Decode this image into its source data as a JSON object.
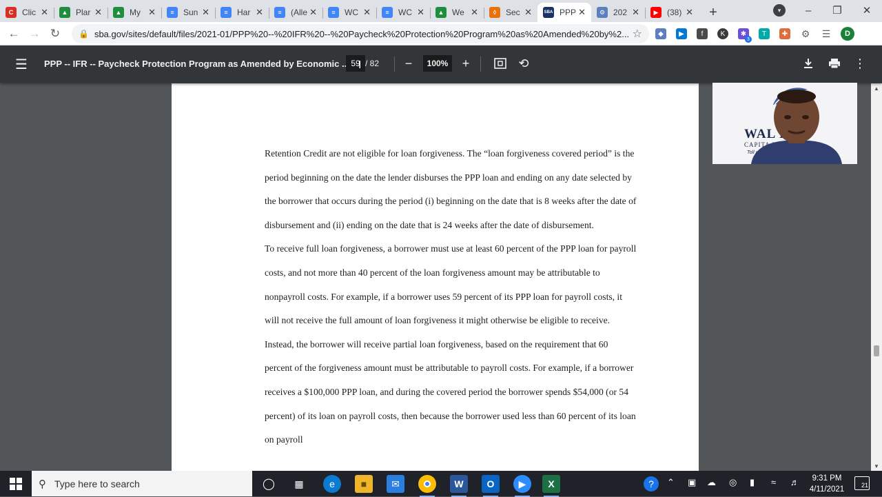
{
  "browser": {
    "tabs": [
      {
        "title": "Clic",
        "fav_color": "#d93025",
        "fav_glyph": "C",
        "icon": "clickup-icon"
      },
      {
        "title": "Plar",
        "fav_color": "#1e8e3e",
        "fav_glyph": "▲",
        "icon": "google-drive-icon"
      },
      {
        "title": "My",
        "fav_color": "#1e8e3e",
        "fav_glyph": "▲",
        "icon": "google-drive-icon"
      },
      {
        "title": "Sun",
        "fav_color": "#4285f4",
        "fav_glyph": "≡",
        "icon": "google-docs-icon"
      },
      {
        "title": "Har",
        "fav_color": "#4285f4",
        "fav_glyph": "≡",
        "icon": "google-docs-icon"
      },
      {
        "title": "(Alle",
        "fav_color": "#4285f4",
        "fav_glyph": "≡",
        "icon": "google-docs-icon"
      },
      {
        "title": "WC",
        "fav_color": "#4285f4",
        "fav_glyph": "≡",
        "icon": "google-docs-icon"
      },
      {
        "title": "WC",
        "fav_color": "#4285f4",
        "fav_glyph": "≡",
        "icon": "google-docs-icon"
      },
      {
        "title": "We",
        "fav_color": "#1e8e3e",
        "fav_glyph": "▲",
        "icon": "google-drive-icon"
      },
      {
        "title": "Sec",
        "fav_color": "#e8710a",
        "fav_glyph": "◊",
        "icon": "document-icon"
      },
      {
        "title": "PPP",
        "fav_color": "#1a3365",
        "fav_glyph": "SBA",
        "icon": "sba-icon",
        "active": true
      },
      {
        "title": "202",
        "fav_color": "#5b7fbf",
        "fav_glyph": "⚙",
        "icon": "settings-icon"
      },
      {
        "title": "(38)",
        "fav_color": "#ff0000",
        "fav_glyph": "▶",
        "icon": "youtube-icon"
      }
    ],
    "url": "sba.gov/sites/default/files/2021-01/PPP%20--%20IFR%20--%20Paycheck%20Protection%20Program%20as%20Amended%20by%2...",
    "profile_initial": "D",
    "extension_badge": "3"
  },
  "pdf": {
    "title": "PPP -- IFR -- Paycheck Protection Program as Amended by Economic ...",
    "page_current": "59",
    "page_total": "/ 82",
    "zoom": "100%"
  },
  "document": {
    "paragraphs": [
      "Retention Credit are not eligible for loan forgiveness.  The “loan forgiveness covered period” is the period beginning on the date the lender disburses the PPP loan and ending on any date selected by the borrower that occurs during the period (i) beginning on the date that is 8 weeks after the date of disbursement and (ii) ending on the date that is 24 weeks after the date of disbursement.",
      "To receive full loan forgiveness, a borrower must use at least 60 percent of the PPP loan for payroll costs, and not more than 40 percent of the loan forgiveness amount may be attributable to nonpayroll costs.  For example, if a borrower uses 59 percent of its PPP loan for payroll costs, it will not receive the full amount of loan forgiveness it might otherwise be eligible to receive.  Instead, the borrower will receive partial loan forgiveness, based on the requirement that 60 percent of the forgiveness amount must be attributable to payroll costs.  For example, if a borrower receives a $100,000 PPP loan, and during the covered period the borrower spends $54,000 (or 54 percent) of its loan on payroll costs, then because the borrower used less than 60 percent of its loan on payroll"
    ]
  },
  "webcam": {
    "brand_line1": "WAL        E",
    "brand_line2": "CAPITA         NG",
    "brand_line3": "Toll           w"
  },
  "taskbar": {
    "search_placeholder": "Type here to search",
    "time": "9:31 PM",
    "date": "4/11/2021",
    "notifications": "21"
  }
}
